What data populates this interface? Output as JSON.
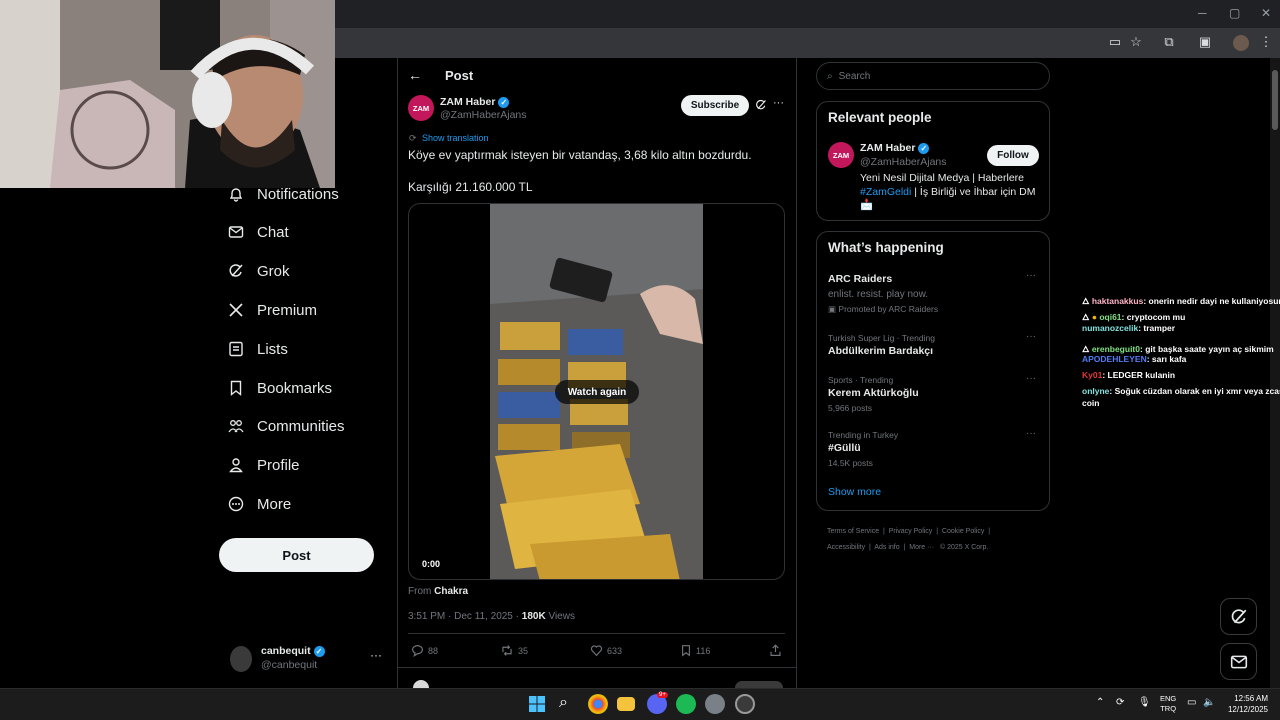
{
  "browser": {
    "window_controls": {
      "minimize": "─",
      "maximize": "▢",
      "close": "✕"
    }
  },
  "nav": {
    "items": [
      {
        "label": "Notifications",
        "icon": "bell-icon"
      },
      {
        "label": "Chat",
        "icon": "mail-icon"
      },
      {
        "label": "Grok",
        "icon": "grok-icon"
      },
      {
        "label": "Premium",
        "icon": "x-logo-icon"
      },
      {
        "label": "Lists",
        "icon": "list-icon"
      },
      {
        "label": "Bookmarks",
        "icon": "bookmark-icon"
      },
      {
        "label": "Communities",
        "icon": "communities-icon"
      },
      {
        "label": "Profile",
        "icon": "person-icon"
      },
      {
        "label": "More",
        "icon": "more-circle-icon"
      }
    ],
    "post_button": "Post",
    "account": {
      "name": "canbequit",
      "handle": "@canbequit",
      "menu": "···"
    }
  },
  "post": {
    "header_title": "Post",
    "author": {
      "name": "ZAM Haber",
      "handle": "@ZamHaberAjans",
      "avatar_text": "ZAM"
    },
    "subscribe_label": "Subscribe",
    "show_translation": "Show translation",
    "text_line1": "Köye ev yaptırmak isteyen bir vatandaş, 3,68 kilo altın bozdurdu.",
    "text_line2": "Karşılığı 21.160.000 TL",
    "video": {
      "overlay_button": "Watch again",
      "timestamp": "0:00"
    },
    "from_label": "From",
    "from_source": "Chakra",
    "meta_time": "3:51 PM · Dec 11, 2025 · ",
    "meta_views_count": "180K",
    "meta_views_label": " Views",
    "stats": {
      "replies": "88",
      "reposts": "35",
      "likes": "633",
      "bookmarks": "116"
    }
  },
  "sidebar": {
    "search_placeholder": "Search",
    "relevant_people": {
      "title": "Relevant people",
      "name": "ZAM Haber",
      "handle": "@ZamHaberAjans",
      "follow_label": "Follow",
      "bio_pre": "Yeni Nesil Dijital Medya | Haberlere ",
      "bio_hashtag": "#ZamGeldi",
      "bio_post": " | İş Birliği ve İhbar için DM",
      "bio_emoji": "📩"
    },
    "whats_happening": {
      "title": "What’s happening",
      "items": [
        {
          "context": "ARC Raiders",
          "title": "enlist. resist. play now.",
          "meta": "Promoted by ARC Raiders"
        },
        {
          "context": "Turkish Super Lig · Trending",
          "title": "Abdülkerim Bardakçı",
          "meta": ""
        },
        {
          "context": "Sports · Trending",
          "title": "Kerem Aktürkoğlu",
          "meta": "5,966 posts"
        },
        {
          "context": "Trending in Turkey",
          "title": "#Güllü",
          "meta": "14.5K posts"
        }
      ],
      "show_more": "Show more"
    },
    "footer_links": [
      "Terms of Service",
      "Privacy Policy",
      "Cookie Policy",
      "Accessibility",
      "Ads info",
      "More ···",
      "© 2025 X Corp."
    ]
  },
  "chat": [
    {
      "user": "haktanakkus",
      "msg": ": onerin nedir dayi ne kullaniyosun",
      "color": "#ffb3c6"
    },
    {
      "user": "oqi61",
      "msg": ": cryptocom mu",
      "color": "#7ee081"
    },
    {
      "user": "numanozcelik",
      "msg": ": tramper",
      "color": "#7fe3e0"
    },
    {
      "user": "erenbeguit0",
      "msg": ": git başka saate yayın aç sikmim",
      "color": "#7ee081"
    },
    {
      "user": "APODEHLEYEN",
      "msg": ": sarı kafa",
      "color": "#4f7df5"
    },
    {
      "user": "Ky01",
      "msg": ": LEDGER kulanin",
      "color": "#e53935"
    },
    {
      "user": "onlyne",
      "msg": ": Soğuk cüzdan olarak en iyi xmr veya zcash",
      "color": "#7fe3e0"
    },
    {
      "user": "",
      "msg": "coin",
      "color": "#ffffff"
    }
  ],
  "taskbar": {
    "lang": "ENG",
    "lang_sub": "TRQ",
    "time": "12:56 AM",
    "date": "12/12/2025",
    "badge": "9+"
  },
  "colors": {
    "accent": "#1d9bf0",
    "brand": "#c2185b",
    "bg": "#000000"
  }
}
